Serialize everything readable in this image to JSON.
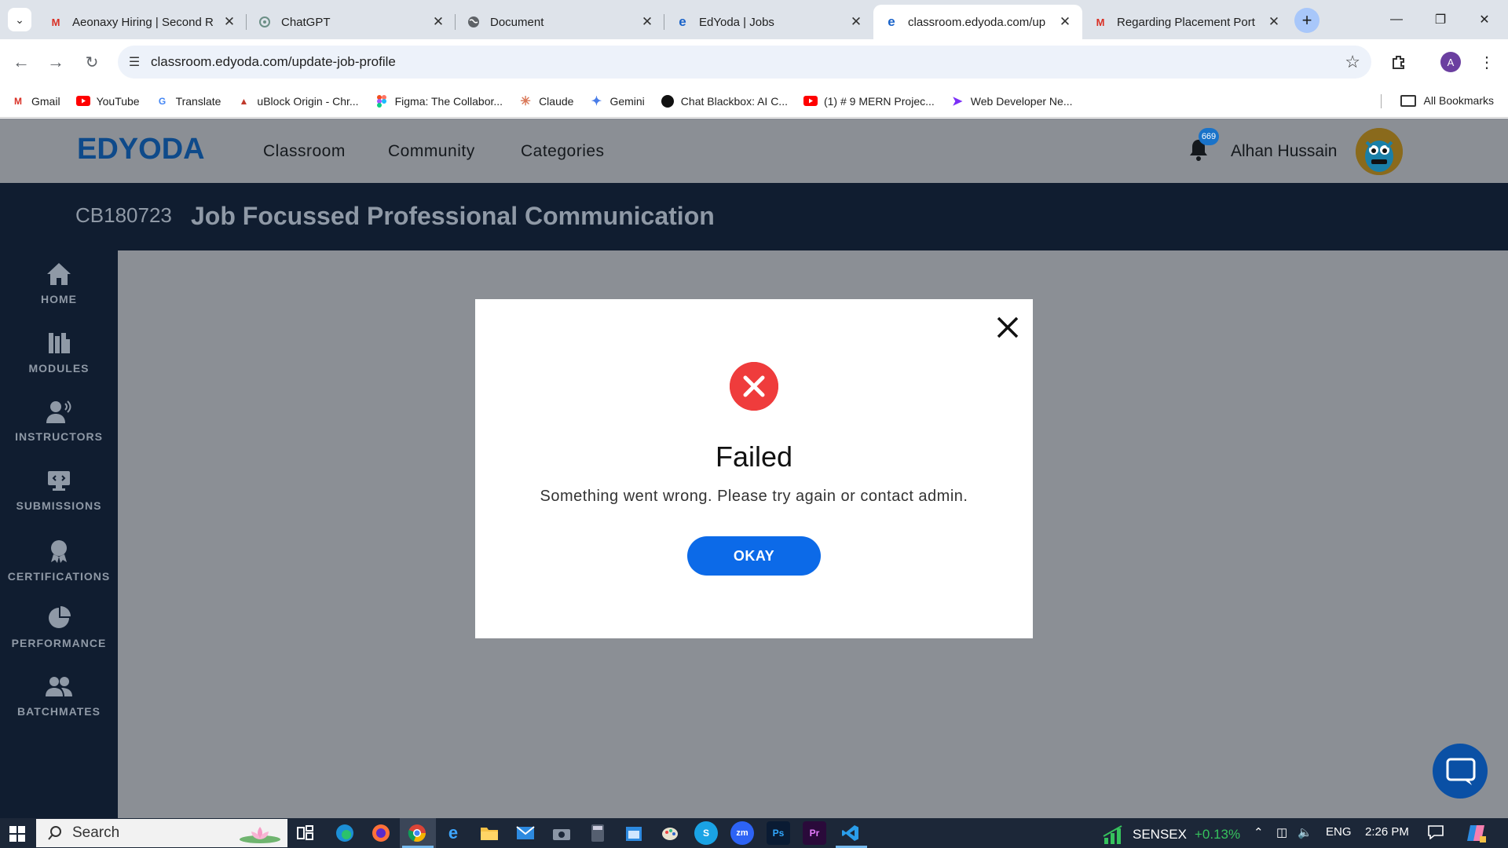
{
  "browser": {
    "tabs": [
      {
        "title": "Aeonaxy Hiring | Second R",
        "icon": "gmail-icon",
        "active": false
      },
      {
        "title": "ChatGPT",
        "icon": "chatgpt-icon",
        "active": false
      },
      {
        "title": "Document",
        "icon": "globe-icon",
        "active": false
      },
      {
        "title": "EdYoda | Jobs",
        "icon": "edyoda-icon",
        "active": false
      },
      {
        "title": "classroom.edyoda.com/up",
        "icon": "edyoda-icon",
        "active": true
      },
      {
        "title": "Regarding Placement Port",
        "icon": "gmail-icon",
        "active": false
      }
    ],
    "url": "classroom.edyoda.com/update-job-profile",
    "profile_initial": "A",
    "bookmarks": [
      {
        "label": "Gmail",
        "icon": "gmail-icon"
      },
      {
        "label": "YouTube",
        "icon": "youtube-icon"
      },
      {
        "label": "Translate",
        "icon": "translate-icon"
      },
      {
        "label": "uBlock Origin - Chr...",
        "icon": "ublock-icon"
      },
      {
        "label": "Figma: The Collabor...",
        "icon": "figma-icon"
      },
      {
        "label": "Claude",
        "icon": "claude-icon"
      },
      {
        "label": "Gemini",
        "icon": "gemini-icon"
      },
      {
        "label": "Chat Blackbox: AI C...",
        "icon": "blackbox-icon"
      },
      {
        "label": "(1) # 9 MERN Projec...",
        "icon": "youtube-icon"
      },
      {
        "label": "Web Developer Ne...",
        "icon": "web-dev-icon"
      }
    ],
    "all_bookmarks": "All Bookmarks"
  },
  "site": {
    "logo": "EDYODA",
    "nav": [
      "Classroom",
      "Community",
      "Categories"
    ],
    "notification_count": "669",
    "username": "Alhan Hussain",
    "course_code": "CB180723",
    "course_title": "Job Focussed Professional Communication",
    "sidebar": [
      {
        "label": "HOME",
        "icon": "home-icon"
      },
      {
        "label": "MODULES",
        "icon": "modules-icon"
      },
      {
        "label": "INSTRUCTORS",
        "icon": "instructor-icon"
      },
      {
        "label": "SUBMISSIONS",
        "icon": "submissions-icon"
      },
      {
        "label": "CERTIFICATIONS",
        "icon": "certificate-icon"
      },
      {
        "label": "PERFORMANCE",
        "icon": "pie-chart-icon"
      },
      {
        "label": "BATCHMATES",
        "icon": "people-icon"
      }
    ]
  },
  "modal": {
    "title": "Failed",
    "message": "Something went wrong. Please try again or contact admin.",
    "button": "OKAY",
    "status_color": "#ef3c3c",
    "button_color": "#0c6ae8"
  },
  "taskbar": {
    "search_placeholder": "Search",
    "ticker_name": "SENSEX",
    "ticker_change": "+0.13%",
    "language": "ENG",
    "time": "2:26 PM"
  }
}
